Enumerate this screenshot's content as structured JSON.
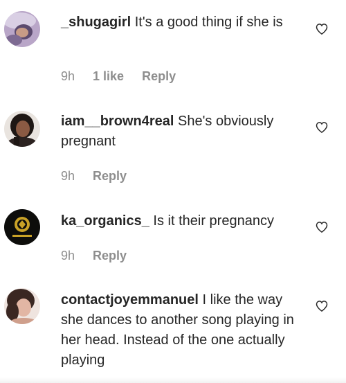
{
  "comments": [
    {
      "username": "_shugagirl",
      "text": "It's a good thing if she is",
      "time": "9h",
      "likes": "1 like",
      "reply": "Reply",
      "avatar_icon": "user-avatar-photo",
      "heart_icon": "heart-outline-icon"
    },
    {
      "username": "iam__brown4real",
      "text": "She's obviously pregnant",
      "time": "9h",
      "likes": "",
      "reply": "Reply",
      "avatar_icon": "user-avatar-photo",
      "heart_icon": "heart-outline-icon"
    },
    {
      "username": "ka_organics_",
      "text": "Is it their pregnancy",
      "time": "9h",
      "likes": "",
      "reply": "Reply",
      "avatar_icon": "brand-logo-avatar",
      "heart_icon": "heart-outline-icon"
    },
    {
      "username": "contactjoyemmanuel",
      "text": "I like the way she dances to another song playing in her head. Instead of the one actually playing",
      "time": "",
      "likes": "",
      "reply": "",
      "avatar_icon": "user-avatar-photo",
      "heart_icon": "heart-outline-icon"
    }
  ],
  "colors": {
    "text": "#262626",
    "meta": "#8e8e8e",
    "background": "#ffffff"
  }
}
